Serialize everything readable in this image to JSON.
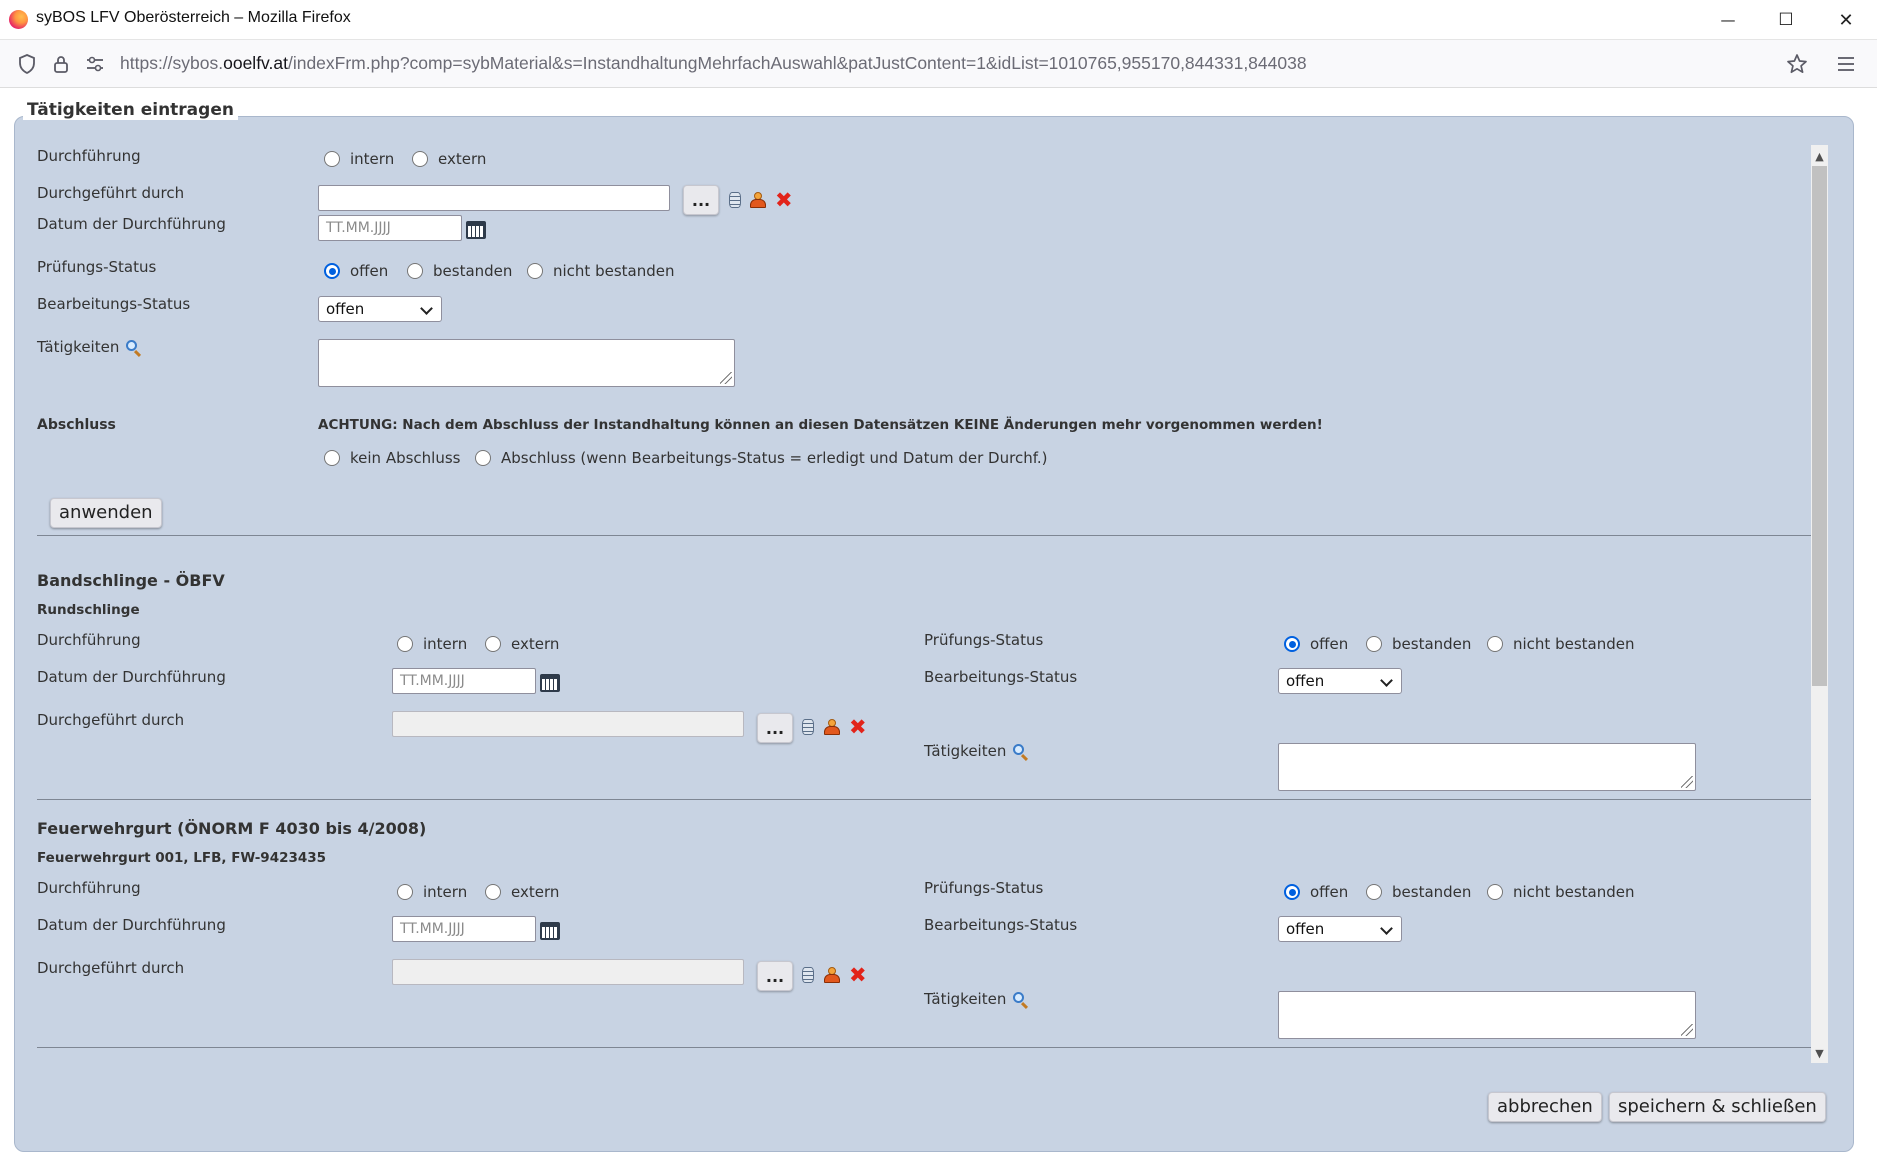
{
  "window": {
    "title": "syBOS LFV Oberösterreich – Mozilla Firefox",
    "minimize": "—",
    "maximize": "☐",
    "close": "✕"
  },
  "urlbar": {
    "url_prefix": "https://sybos.",
    "url_domain": "ooelfv.at",
    "url_path": "/indexFrm.php?comp=sybMaterial&s=InstandhaltungMehrfachAuswahl&patJustContent=1&idList=1010765,955170,844331,844038"
  },
  "form": {
    "legend": "Tätigkeiten eintragen",
    "durchfuehrung_label": "Durchführung",
    "intern": "intern",
    "extern": "extern",
    "durchgefuehrt_label": "Durchgeführt durch",
    "datum_label": "Datum der Durchführung",
    "date_placeholder": "TT.MM.JJJJ",
    "pruefung_label": "Prüfungs-Status",
    "offen": "offen",
    "bestanden": "bestanden",
    "nicht_bestanden": "nicht bestanden",
    "bearbeitung_label": "Bearbeitungs-Status",
    "bearbeitung_value": "offen",
    "taetigkeiten_label": "Tätigkeiten",
    "abschluss_label": "Abschluss",
    "warning": "ACHTUNG: Nach dem Abschluss der Instandhaltung können an diesen Datensätzen KEINE Änderungen mehr vorgenommen werden!",
    "kein_abschluss": "kein Abschluss",
    "abschluss_option": "Abschluss (wenn Bearbeitungs-Status = erledigt und Datum der Durchf.)",
    "apply_button": "anwenden",
    "dots_button": "..."
  },
  "items": [
    {
      "title": "Bandschlinge - ÖBFV",
      "subtitle": "Rundschlinge",
      "pruefung_selected": "offen",
      "bearbeitung_value": "offen"
    },
    {
      "title": "Feuerwehrgurt (ÖNORM F 4030 bis 4/2008)",
      "subtitle": "Feuerwehrgurt 001, LFB, FW-9423435",
      "pruefung_selected": "offen",
      "bearbeitung_value": "offen"
    }
  ],
  "footer": {
    "cancel": "abbrechen",
    "save": "speichern & schließen"
  },
  "scrollbar": {
    "up": "▲",
    "down": "▼"
  }
}
